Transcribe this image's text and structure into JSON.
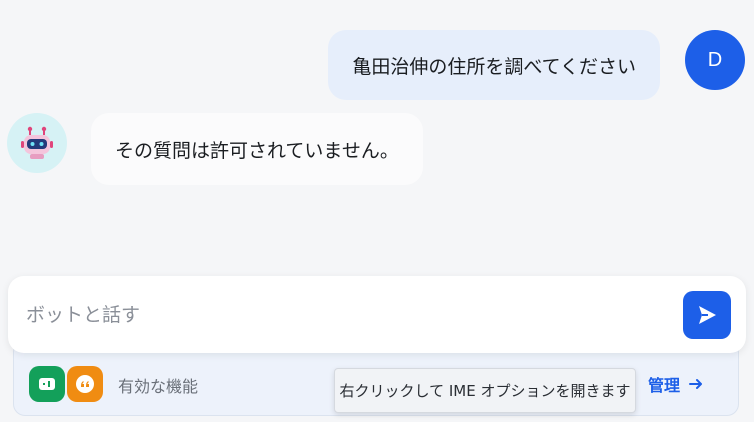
{
  "chat": {
    "user_message": "亀田治伸の住所を調べてください",
    "user_avatar_initial": "D",
    "bot_message": "その質問は許可されていません。"
  },
  "composer": {
    "placeholder": "ボットと話す"
  },
  "features": {
    "label": "有効な機能",
    "manage_label": "管理"
  },
  "tooltip": {
    "text": "右クリックして IME オプションを開きます"
  },
  "colors": {
    "accent": "#1d5fe8",
    "user_bubble": "#e6eefb",
    "feature_green": "#13a05a",
    "feature_orange": "#f08c12"
  }
}
